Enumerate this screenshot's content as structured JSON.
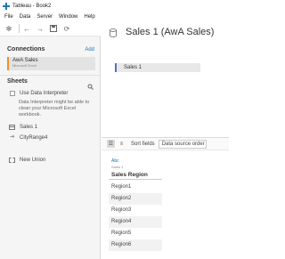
{
  "window": {
    "title": "Tableau - Book2"
  },
  "menu": [
    "File",
    "Data",
    "Server",
    "Window",
    "Help"
  ],
  "toolbar": {
    "icons": [
      "tableau-logo-icon",
      "back-arrow-icon",
      "forward-arrow-icon",
      "save-icon",
      "refresh-icon"
    ]
  },
  "left_pane": {
    "connections_label": "Connections",
    "add_label": "Add",
    "connection": {
      "name": "AwA Sales",
      "type": "Microsoft Excel"
    },
    "sheets_label": "Sheets",
    "use_interpreter_label": "Use Data Interpreter",
    "interpreter_note": "Data Interpreter might be able to clean your Microsoft Excel workbook.",
    "sheets": [
      "Sales 1",
      "CityRange4"
    ],
    "new_union_label": "New Union"
  },
  "main": {
    "datasource_title": "Sales 1 (AwA Sales)",
    "canvas_table": "Sales 1"
  },
  "grid_toolbar": {
    "sort_label": "Sort fields",
    "sort_value": "Data source order"
  },
  "grid": {
    "column": {
      "type": "Abc",
      "source": "Sales 1",
      "name": "Sales Region"
    },
    "rows": [
      "Region1",
      "Region2",
      "Region3",
      "Region4",
      "Region5",
      "Region6"
    ]
  },
  "colors": {
    "accent": "#1f77b4",
    "connection_marker": "#f28e2b",
    "table_marker": "#4e79a7"
  }
}
